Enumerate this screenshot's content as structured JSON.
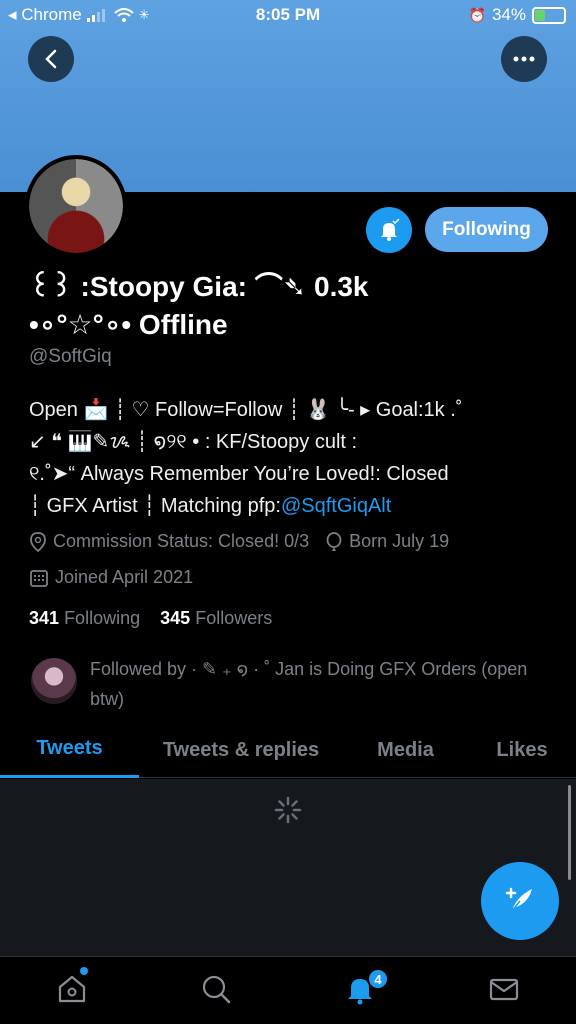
{
  "status_bar": {
    "back_app": "◂ Chrome",
    "time": "8:05 PM",
    "battery": "34%",
    "battery_level": 0.34
  },
  "profile": {
    "name_line1": "꒰꒱ :Stoopy Gia: ⌒➴ 0.3k",
    "name_line2": "•∘°☆°∘• Offline",
    "handle": "@SoftGiq",
    "bio_line1": "Open 📩 ┊ ♡ Follow=Follow ┊ 🐰 ╰- ▸ Goal:1k .˚",
    "bio_line2": "↙ ❝ 🎹✎ᝰ ┊ ໑୨୧ • : KF/Stoopy cult :",
    "bio_line3": "୧.˚➤“ Always Remember You’re Loved!: Closed",
    "bio_line4_prefix": "┆ GFX Artist ┆ Matching pfp:",
    "bio_link": "@SqftGiqAlt",
    "commission": "Commission Status: Closed! 0/3",
    "born": "Born July 19",
    "joined": "Joined April 2021",
    "following_count": "341",
    "following_label": "Following",
    "followers_count": "345",
    "followers_label": "Followers",
    "followed_by": "Followed by · ✎ ₊ ໑ · ˚ Jan is Doing GFX Orders (open btw)",
    "follow_button": "Following"
  },
  "tabs": [
    {
      "label": "Tweets"
    },
    {
      "label": "Tweets & replies"
    },
    {
      "label": "Media"
    },
    {
      "label": "Likes"
    }
  ],
  "notifications_badge": "4",
  "icons": {
    "back": "chevron-left-icon",
    "more": "more-horizontal-icon",
    "bell": "bell-plus-icon",
    "compose": "feather-compose-icon",
    "home": "home-icon",
    "search": "search-icon",
    "notifications": "bell-icon",
    "messages": "mail-icon"
  },
  "colors": {
    "accent": "#1d9bf0",
    "banner": "#5fa2e2",
    "muted": "#7c8188"
  }
}
